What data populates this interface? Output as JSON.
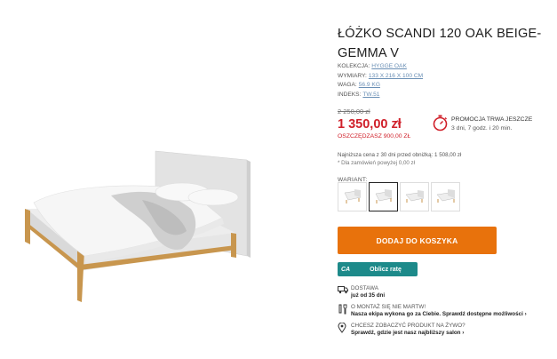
{
  "product": {
    "title": "ŁÓŻKO SCANDI 120 OAK BEIGE-GEMMA V",
    "specs": [
      {
        "key": "KOLEKCJA:",
        "value": "HYGGE OAK"
      },
      {
        "key": "WYMIARY:",
        "value": "133 X 216 X 100 CM"
      },
      {
        "key": "WAGA:",
        "value": "56.9 KG"
      },
      {
        "key": "INDEKS:",
        "value": "TW.51"
      }
    ]
  },
  "pricing": {
    "old_price": "2 250,00 zł",
    "price": "1 350,00 zł",
    "price_marker": "*",
    "savings": "OSZCZĘDZASZ 900,00 ZŁ",
    "lowest_30": "Najniższa cena z 30 dni przed obniżką: 1 508,00 zł",
    "note": "* Dla zamówień powyżej 0,00 zł"
  },
  "promo": {
    "line1": "PROMOCJA TRWA JESZCZE",
    "line2": "3 dni, 7 godz. i 20 min.",
    "icon": "stopwatch-icon"
  },
  "variants": {
    "label": "WARIANT:",
    "selected_index": 1,
    "count": 4
  },
  "actions": {
    "add_to_cart": "DODAJ DO KOSZYKA",
    "installment": "Oblicz ratę",
    "installment_logo": "CA"
  },
  "features": [
    {
      "icon": "truck-icon",
      "line1": "DOSTAWA",
      "line2": "już od 35 dni"
    },
    {
      "icon": "tools-icon",
      "line1": "O MONTAŻ SIĘ NIE MARTW!",
      "line2": "Nasza ekipa wykona go za Ciebie. Sprawdź dostępne możliwości ›"
    },
    {
      "icon": "location-pin-icon",
      "line1": "CHCESZ ZOBACZYĆ PRODUKT NA ŻYWO?",
      "line2": "Sprawdź, gdzie jest nasz najbliższy salon ›"
    }
  ],
  "colors": {
    "accent_orange": "#e8720c",
    "price_red": "#d0202a",
    "teal": "#1d8a8a"
  }
}
